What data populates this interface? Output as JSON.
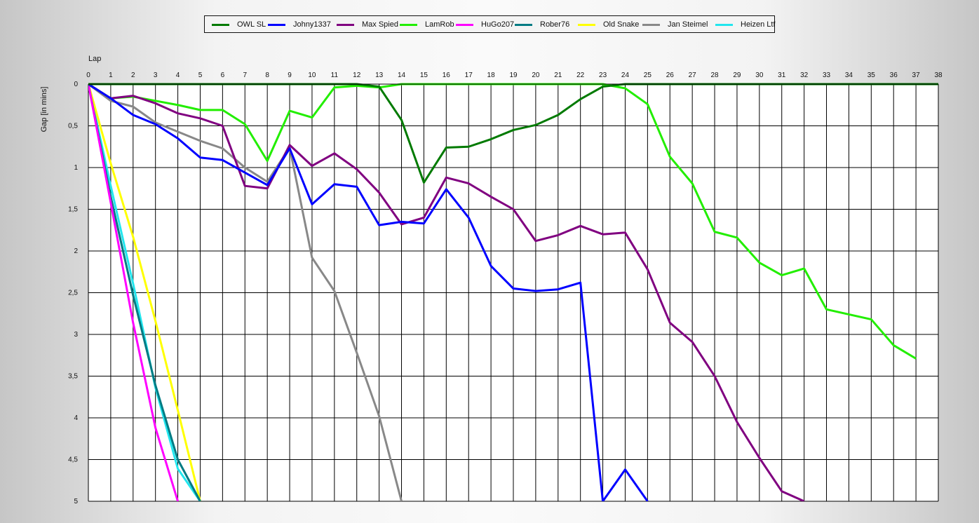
{
  "chart_data": {
    "type": "line",
    "xlabel": "Lap",
    "ylabel": "Gap [in mins]",
    "x_ticks": [
      0,
      1,
      2,
      3,
      4,
      5,
      6,
      7,
      8,
      9,
      10,
      11,
      12,
      13,
      14,
      15,
      16,
      17,
      18,
      19,
      20,
      21,
      22,
      23,
      24,
      25,
      26,
      27,
      28,
      29,
      30,
      31,
      32,
      33,
      34,
      35,
      36,
      37,
      38
    ],
    "y_ticks": [
      "0",
      "0,5",
      "1",
      "1,5",
      "2",
      "2,5",
      "3",
      "3,5",
      "4",
      "4,5",
      "5"
    ],
    "xlim": [
      0,
      38
    ],
    "ylim": [
      0,
      5
    ],
    "y_inverted": true,
    "grid": true,
    "legend_position": "top",
    "series": [
      {
        "name": "OWL SL",
        "color": "#007a00",
        "points": [
          [
            0,
            0
          ],
          [
            1,
            0
          ],
          [
            2,
            0
          ],
          [
            3,
            0
          ],
          [
            4,
            0
          ],
          [
            5,
            0
          ],
          [
            6,
            0
          ],
          [
            7,
            0
          ],
          [
            8,
            0
          ],
          [
            9,
            0
          ],
          [
            10,
            0
          ],
          [
            11,
            0
          ],
          [
            12,
            0
          ],
          [
            13,
            0.03
          ],
          [
            14,
            0.43
          ],
          [
            15,
            1.18
          ],
          [
            16,
            0.76
          ],
          [
            17,
            0.75
          ],
          [
            18,
            0.66
          ],
          [
            19,
            0.55
          ],
          [
            20,
            0.49
          ],
          [
            21,
            0.37
          ],
          [
            22,
            0.18
          ],
          [
            23,
            0.03
          ],
          [
            24,
            0
          ],
          [
            25,
            0
          ],
          [
            26,
            0
          ],
          [
            27,
            0
          ],
          [
            28,
            0
          ],
          [
            29,
            0
          ],
          [
            30,
            0
          ],
          [
            31,
            0
          ],
          [
            32,
            0
          ],
          [
            33,
            0
          ],
          [
            34,
            0
          ],
          [
            35,
            0
          ],
          [
            36,
            0
          ],
          [
            37,
            0
          ],
          [
            38,
            0
          ]
        ]
      },
      {
        "name": "Johny1337",
        "color": "#0000ff",
        "points": [
          [
            0,
            0
          ],
          [
            1,
            0.17
          ],
          [
            2,
            0.37
          ],
          [
            3,
            0.48
          ],
          [
            4,
            0.65
          ],
          [
            5,
            0.88
          ],
          [
            6,
            0.91
          ],
          [
            7,
            1.06
          ],
          [
            8,
            1.21
          ],
          [
            9,
            0.77
          ],
          [
            10,
            1.44
          ],
          [
            11,
            1.2
          ],
          [
            12,
            1.23
          ],
          [
            13,
            1.69
          ],
          [
            14,
            1.65
          ],
          [
            15,
            1.67
          ],
          [
            16,
            1.26
          ],
          [
            17,
            1.6
          ],
          [
            18,
            2.18
          ],
          [
            19,
            2.45
          ],
          [
            20,
            2.48
          ],
          [
            21,
            2.46
          ],
          [
            22,
            2.38
          ],
          [
            23,
            5.0
          ],
          [
            24,
            4.62
          ],
          [
            25,
            5.0
          ]
        ]
      },
      {
        "name": "Max Spied",
        "color": "#800080",
        "points": [
          [
            0,
            0
          ],
          [
            1,
            0.17
          ],
          [
            2,
            0.14
          ],
          [
            3,
            0.23
          ],
          [
            4,
            0.35
          ],
          [
            5,
            0.41
          ],
          [
            6,
            0.5
          ],
          [
            7,
            1.22
          ],
          [
            8,
            1.25
          ],
          [
            9,
            0.73
          ],
          [
            10,
            0.98
          ],
          [
            11,
            0.83
          ],
          [
            12,
            1.02
          ],
          [
            13,
            1.3
          ],
          [
            14,
            1.68
          ],
          [
            15,
            1.6
          ],
          [
            16,
            1.12
          ],
          [
            17,
            1.19
          ],
          [
            18,
            1.35
          ],
          [
            19,
            1.5
          ],
          [
            20,
            1.88
          ],
          [
            21,
            1.81
          ],
          [
            22,
            1.7
          ],
          [
            23,
            1.8
          ],
          [
            24,
            1.78
          ],
          [
            25,
            2.22
          ],
          [
            26,
            2.86
          ],
          [
            27,
            3.09
          ],
          [
            28,
            3.5
          ],
          [
            29,
            4.05
          ],
          [
            30,
            4.48
          ],
          [
            31,
            4.88
          ],
          [
            32,
            5.0
          ]
        ]
      },
      {
        "name": "LamRob",
        "color": "#22ee00",
        "points": [
          [
            0,
            0
          ],
          [
            1,
            0.17
          ],
          [
            2,
            0.15
          ],
          [
            3,
            0.2
          ],
          [
            4,
            0.25
          ],
          [
            5,
            0.31
          ],
          [
            6,
            0.31
          ],
          [
            7,
            0.48
          ],
          [
            8,
            0.92
          ],
          [
            9,
            0.32
          ],
          [
            10,
            0.4
          ],
          [
            11,
            0.04
          ],
          [
            12,
            0.02
          ],
          [
            13,
            0.04
          ],
          [
            14,
            0
          ],
          [
            15,
            0
          ],
          [
            16,
            0
          ],
          [
            17,
            0
          ],
          [
            18,
            0
          ],
          [
            19,
            0
          ],
          [
            20,
            0
          ],
          [
            21,
            0
          ],
          [
            22,
            0
          ],
          [
            23,
            0
          ],
          [
            24,
            0.05
          ],
          [
            25,
            0.24
          ],
          [
            26,
            0.87
          ],
          [
            27,
            1.19
          ],
          [
            28,
            1.77
          ],
          [
            29,
            1.84
          ],
          [
            30,
            2.14
          ],
          [
            31,
            2.29
          ],
          [
            32,
            2.21
          ],
          [
            33,
            2.7
          ],
          [
            34,
            2.76
          ],
          [
            35,
            2.82
          ],
          [
            36,
            3.13
          ],
          [
            37,
            3.29
          ]
        ]
      },
      {
        "name": "HuGo207",
        "color": "#ff00ff",
        "points": [
          [
            0,
            0
          ],
          [
            1,
            1.42
          ],
          [
            2,
            2.86
          ],
          [
            3,
            4.12
          ],
          [
            4,
            5.0
          ]
        ]
      },
      {
        "name": "Rober76",
        "color": "#007b83",
        "points": [
          [
            0,
            0
          ],
          [
            1,
            1.35
          ],
          [
            2,
            2.53
          ],
          [
            3,
            3.61
          ],
          [
            4,
            4.5
          ],
          [
            5,
            5.0
          ]
        ]
      },
      {
        "name": "Old Snake",
        "color": "#ffff00",
        "points": [
          [
            0,
            0
          ],
          [
            1,
            0.95
          ],
          [
            2,
            1.83
          ],
          [
            3,
            2.84
          ],
          [
            4,
            3.91
          ],
          [
            5,
            5.0
          ]
        ]
      },
      {
        "name": "Jan Steimel",
        "color": "#888888",
        "points": [
          [
            0,
            0
          ],
          [
            1,
            0.2
          ],
          [
            2,
            0.27
          ],
          [
            3,
            0.46
          ],
          [
            4,
            0.57
          ],
          [
            5,
            0.68
          ],
          [
            6,
            0.77
          ],
          [
            7,
            1.0
          ],
          [
            8,
            1.17
          ],
          [
            9,
            0.76
          ],
          [
            10,
            2.08
          ],
          [
            11,
            2.48
          ],
          [
            12,
            3.22
          ],
          [
            13,
            3.98
          ],
          [
            14,
            5.0
          ]
        ]
      },
      {
        "name": "Heizen Ltf",
        "color": "#22e6ee",
        "points": [
          [
            0,
            0
          ],
          [
            1,
            1.22
          ],
          [
            2,
            2.39
          ],
          [
            3,
            3.64
          ],
          [
            4,
            4.61
          ],
          [
            5,
            5.0
          ]
        ]
      }
    ]
  }
}
